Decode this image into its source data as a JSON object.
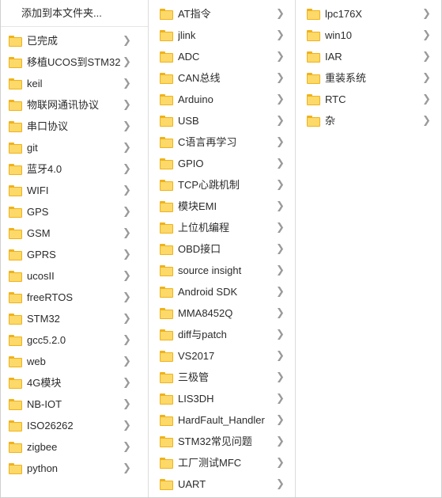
{
  "menu": {
    "header": {
      "label": "添加到本文件夹...",
      "icon": "none"
    },
    "columns": [
      {
        "id": "column-1",
        "has_header": true,
        "items": [
          {
            "label": "已完成",
            "icon": "folder-icon",
            "submenu_icon": "chevron-right-icon"
          },
          {
            "label": "移植UCOS到STM32",
            "icon": "folder-icon",
            "submenu_icon": "chevron-right-icon"
          },
          {
            "label": "keil",
            "icon": "folder-icon",
            "submenu_icon": "chevron-right-icon"
          },
          {
            "label": "物联网通讯协议",
            "icon": "folder-icon",
            "submenu_icon": "chevron-right-icon"
          },
          {
            "label": "串口协议",
            "icon": "folder-icon",
            "submenu_icon": "chevron-right-icon"
          },
          {
            "label": "git",
            "icon": "folder-icon",
            "submenu_icon": "chevron-right-icon"
          },
          {
            "label": "蓝牙4.0",
            "icon": "folder-icon",
            "submenu_icon": "chevron-right-icon"
          },
          {
            "label": "WIFI",
            "icon": "folder-icon",
            "submenu_icon": "chevron-right-icon"
          },
          {
            "label": "GPS",
            "icon": "folder-icon",
            "submenu_icon": "chevron-right-icon"
          },
          {
            "label": "GSM",
            "icon": "folder-icon",
            "submenu_icon": "chevron-right-icon"
          },
          {
            "label": "GPRS",
            "icon": "folder-icon",
            "submenu_icon": "chevron-right-icon"
          },
          {
            "label": "ucosII",
            "icon": "folder-icon",
            "submenu_icon": "chevron-right-icon"
          },
          {
            "label": "freeRTOS",
            "icon": "folder-icon",
            "submenu_icon": "chevron-right-icon"
          },
          {
            "label": "STM32",
            "icon": "folder-icon",
            "submenu_icon": "chevron-right-icon"
          },
          {
            "label": "gcc5.2.0",
            "icon": "folder-icon",
            "submenu_icon": "chevron-right-icon"
          },
          {
            "label": "web",
            "icon": "folder-icon",
            "submenu_icon": "chevron-right-icon"
          },
          {
            "label": "4G模块",
            "icon": "folder-icon",
            "submenu_icon": "chevron-right-icon"
          },
          {
            "label": "NB-IOT",
            "icon": "folder-icon",
            "submenu_icon": "chevron-right-icon"
          },
          {
            "label": "ISO26262",
            "icon": "folder-icon",
            "submenu_icon": "chevron-right-icon"
          },
          {
            "label": "zigbee",
            "icon": "folder-icon",
            "submenu_icon": "chevron-right-icon"
          },
          {
            "label": "python",
            "icon": "folder-icon",
            "submenu_icon": "chevron-right-icon"
          }
        ]
      },
      {
        "id": "column-2",
        "has_header": false,
        "items": [
          {
            "label": "AT指令",
            "icon": "folder-icon",
            "submenu_icon": "chevron-right-icon"
          },
          {
            "label": "jlink",
            "icon": "folder-icon",
            "submenu_icon": "chevron-right-icon"
          },
          {
            "label": "ADC",
            "icon": "folder-icon",
            "submenu_icon": "chevron-right-icon"
          },
          {
            "label": "CAN总线",
            "icon": "folder-icon",
            "submenu_icon": "chevron-right-icon"
          },
          {
            "label": "Arduino",
            "icon": "folder-icon",
            "submenu_icon": "chevron-right-icon"
          },
          {
            "label": "USB",
            "icon": "folder-icon",
            "submenu_icon": "chevron-right-icon"
          },
          {
            "label": "C语言再学习",
            "icon": "folder-icon",
            "submenu_icon": "chevron-right-icon"
          },
          {
            "label": "GPIO",
            "icon": "folder-icon",
            "submenu_icon": "chevron-right-icon"
          },
          {
            "label": "TCP心跳机制",
            "icon": "folder-icon",
            "submenu_icon": "chevron-right-icon"
          },
          {
            "label": "模块EMI",
            "icon": "folder-icon",
            "submenu_icon": "chevron-right-icon"
          },
          {
            "label": "上位机编程",
            "icon": "folder-icon",
            "submenu_icon": "chevron-right-icon"
          },
          {
            "label": "OBD接口",
            "icon": "folder-icon",
            "submenu_icon": "chevron-right-icon"
          },
          {
            "label": "source insight",
            "icon": "folder-icon",
            "submenu_icon": "chevron-right-icon"
          },
          {
            "label": "Android SDK",
            "icon": "folder-icon",
            "submenu_icon": "chevron-right-icon"
          },
          {
            "label": "MMA8452Q",
            "icon": "folder-icon",
            "submenu_icon": "chevron-right-icon"
          },
          {
            "label": "diff与patch",
            "icon": "folder-icon",
            "submenu_icon": "chevron-right-icon"
          },
          {
            "label": "VS2017",
            "icon": "folder-icon",
            "submenu_icon": "chevron-right-icon"
          },
          {
            "label": "三极管",
            "icon": "folder-icon",
            "submenu_icon": "chevron-right-icon"
          },
          {
            "label": "LIS3DH",
            "icon": "folder-icon",
            "submenu_icon": "chevron-right-icon"
          },
          {
            "label": "HardFault_Handler",
            "icon": "folder-icon",
            "submenu_icon": "chevron-right-icon"
          },
          {
            "label": "STM32常见问题",
            "icon": "folder-icon",
            "submenu_icon": "chevron-right-icon"
          },
          {
            "label": "工厂测试MFC",
            "icon": "folder-icon",
            "submenu_icon": "chevron-right-icon"
          },
          {
            "label": "UART",
            "icon": "folder-icon",
            "submenu_icon": "chevron-right-icon"
          }
        ]
      },
      {
        "id": "column-3",
        "has_header": false,
        "items": [
          {
            "label": "lpc176X",
            "icon": "folder-icon",
            "submenu_icon": "chevron-right-icon"
          },
          {
            "label": "win10",
            "icon": "folder-icon",
            "submenu_icon": "chevron-right-icon"
          },
          {
            "label": "IAR",
            "icon": "folder-icon",
            "submenu_icon": "chevron-right-icon"
          },
          {
            "label": "重装系统",
            "icon": "folder-icon",
            "submenu_icon": "chevron-right-icon"
          },
          {
            "label": "RTC",
            "icon": "folder-icon",
            "submenu_icon": "chevron-right-icon"
          },
          {
            "label": "杂",
            "icon": "folder-icon",
            "submenu_icon": "chevron-right-icon"
          }
        ]
      }
    ]
  },
  "icons": {
    "chevron_right": "❯"
  },
  "colors": {
    "folder_fill": "#fcd968",
    "folder_stroke": "#f0b21a",
    "text": "#2b2b2b",
    "chevron": "#9a9a9a",
    "divider": "#dcdcdc",
    "border": "#cfcfcf",
    "background": "#ffffff"
  }
}
